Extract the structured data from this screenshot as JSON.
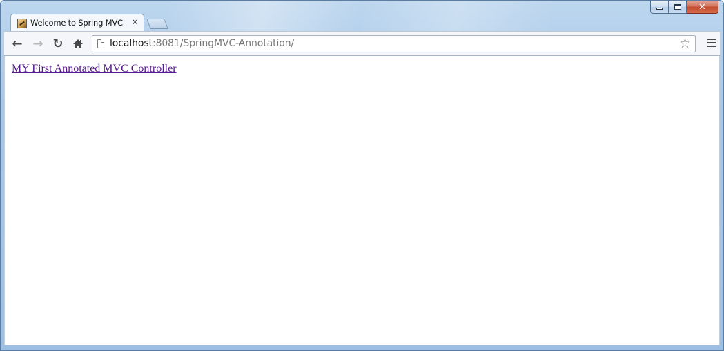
{
  "window": {
    "caption_buttons": {
      "minimize": "minimize",
      "maximize": "maximize",
      "close": "✕"
    }
  },
  "tabs": [
    {
      "title": "Welcome to Spring MVC",
      "close_label": "×",
      "favicon": "spring-leaf-icon"
    }
  ],
  "toolbar": {
    "back_icon": "←",
    "forward_icon": "→",
    "reload_icon": "↻",
    "home_icon": "home-icon",
    "url_host": "localhost",
    "url_rest": ":8081/SpringMVC-Annotation/",
    "star_icon": "☆",
    "menu_icon": "hamburger-menu-icon"
  },
  "page": {
    "link_text": "MY First Annotated MVC Controller",
    "link_color": "#551a8b"
  }
}
